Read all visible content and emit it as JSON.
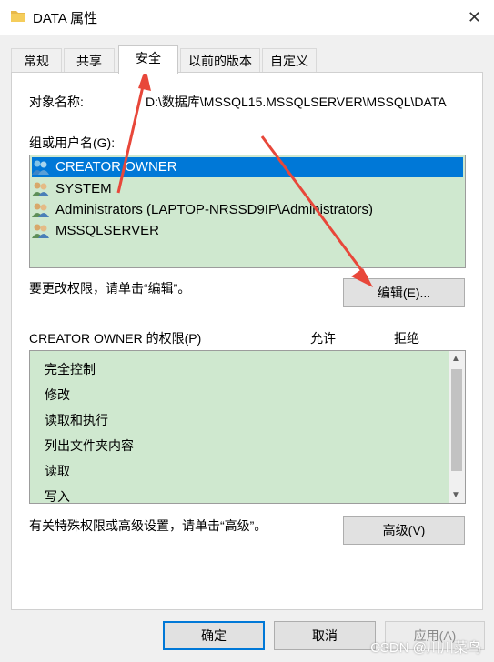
{
  "window": {
    "title": "DATA 属性",
    "close_glyph": "✕"
  },
  "tabs": [
    {
      "label": "常规"
    },
    {
      "label": "共享"
    },
    {
      "label": "安全"
    },
    {
      "label": "以前的版本"
    },
    {
      "label": "自定义"
    }
  ],
  "security": {
    "object_name_label": "对象名称:",
    "object_name_value": "D:\\数据库\\MSSQL15.MSSQLSERVER\\MSSQL\\DATA",
    "groups_label": "组或用户名(G):",
    "groups": [
      {
        "name": "CREATOR OWNER",
        "selected": true
      },
      {
        "name": "SYSTEM",
        "selected": false
      },
      {
        "name": "Administrators (LAPTOP-NRSSD9IP\\Administrators)",
        "selected": false
      },
      {
        "name": "MSSQLSERVER",
        "selected": false
      }
    ],
    "change_hint": "要更改权限，请单击“编辑”。",
    "edit_button": "编辑(E)...",
    "permissions_label": "CREATOR OWNER 的权限(P)",
    "allow_header": "允许",
    "deny_header": "拒绝",
    "permissions": [
      {
        "name": "完全控制"
      },
      {
        "name": "修改"
      },
      {
        "name": "读取和执行"
      },
      {
        "name": "列出文件夹内容"
      },
      {
        "name": "读取"
      },
      {
        "name": "写入"
      }
    ],
    "advanced_hint": "有关特殊权限或高级设置，请单击“高级”。",
    "advanced_button": "高级(V)"
  },
  "footer": {
    "ok_button": "确定",
    "cancel_button": "取消",
    "apply_button": "应用(A)"
  },
  "watermark": "CSDN @川川菜鸟",
  "colors": {
    "selection": "#0078d7",
    "list_background": "#cfe8cf",
    "annotation_arrow": "#e8473a"
  }
}
